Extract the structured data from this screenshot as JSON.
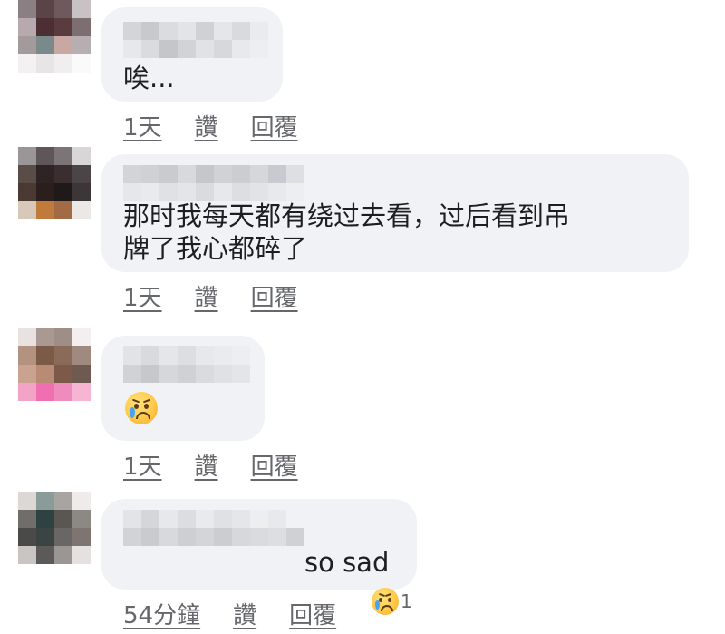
{
  "comments": [
    {
      "text": "唉...",
      "actions": {
        "time": "1天",
        "like": "讚",
        "reply": "回覆"
      }
    },
    {
      "text_lines": [
        "那时我每天都有绕过去看，过后看到吊",
        "牌了我心都碎了"
      ],
      "actions": {
        "time": "1天",
        "like": "讚",
        "reply": "回覆"
      }
    },
    {
      "emoji": "crying-face",
      "actions": {
        "time": "1天",
        "like": "讚",
        "reply": "回覆"
      }
    },
    {
      "text": "so sad",
      "actions": {
        "time": "54分鐘",
        "like": "讚",
        "reply": "回覆"
      },
      "reaction": {
        "icon": "crying-face",
        "count": "1"
      }
    }
  ],
  "colors": {
    "bubble": "#f0f2f5",
    "action_text": "#65676b",
    "body_text": "#1c1e21"
  }
}
